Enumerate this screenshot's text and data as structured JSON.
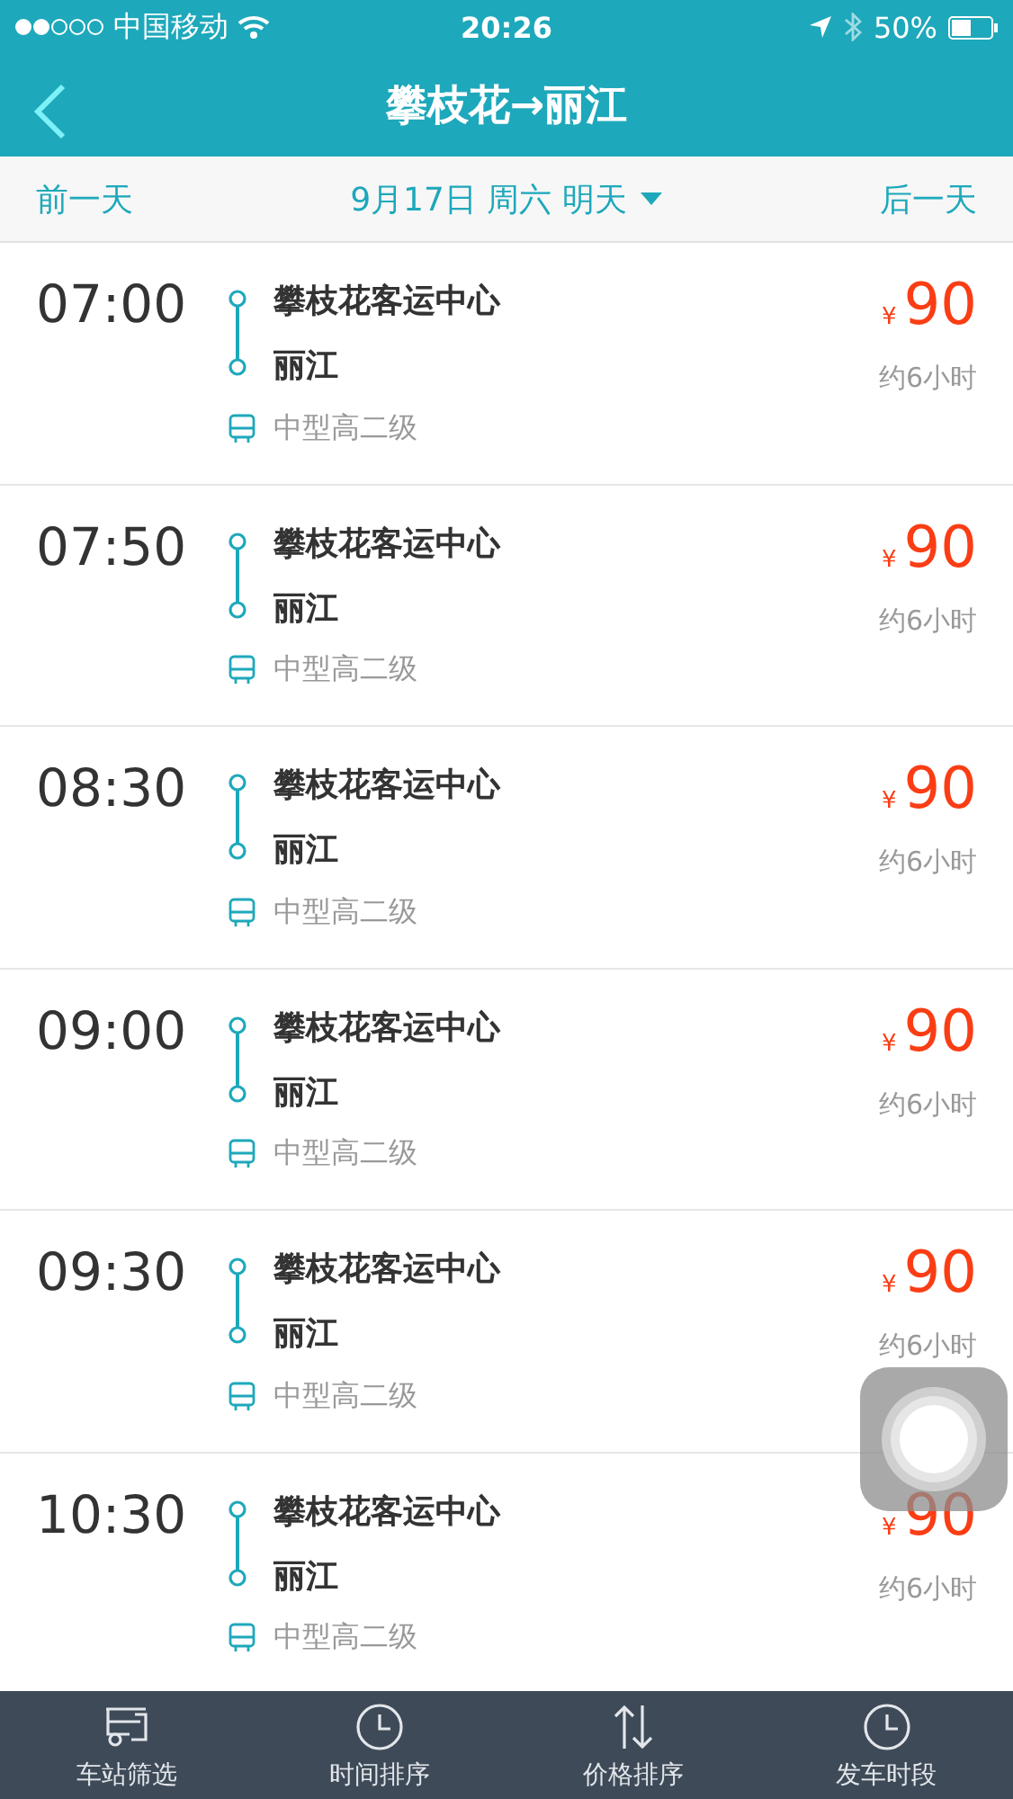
{
  "status_bar": {
    "carrier": "中国移动",
    "time": "20:26",
    "battery": "50%"
  },
  "nav": {
    "title": "攀枝花→丽江"
  },
  "date_bar": {
    "prev": "前一天",
    "date": "9月17日 周六 明天",
    "next": "后一天"
  },
  "trips": [
    {
      "time": "07:00",
      "from": "攀枝花客运中心",
      "to": "丽江",
      "bus_type": "中型高二级",
      "currency": "¥",
      "price": "90",
      "duration": "约6小时"
    },
    {
      "time": "07:50",
      "from": "攀枝花客运中心",
      "to": "丽江",
      "bus_type": "中型高二级",
      "currency": "¥",
      "price": "90",
      "duration": "约6小时"
    },
    {
      "time": "08:30",
      "from": "攀枝花客运中心",
      "to": "丽江",
      "bus_type": "中型高二级",
      "currency": "¥",
      "price": "90",
      "duration": "约6小时"
    },
    {
      "time": "09:00",
      "from": "攀枝花客运中心",
      "to": "丽江",
      "bus_type": "中型高二级",
      "currency": "¥",
      "price": "90",
      "duration": "约6小时"
    },
    {
      "time": "09:30",
      "from": "攀枝花客运中心",
      "to": "丽江",
      "bus_type": "中型高二级",
      "currency": "¥",
      "price": "90",
      "duration": "约6小时"
    },
    {
      "time": "10:30",
      "from": "攀枝花客运中心",
      "to": "丽江",
      "bus_type": "中型高二级",
      "currency": "¥",
      "price": "90",
      "duration": "约6小时"
    }
  ],
  "toolbar": [
    {
      "kind": "station",
      "label": "车站筛选"
    },
    {
      "kind": "time",
      "label": "时间排序"
    },
    {
      "kind": "price",
      "label": "价格排序"
    },
    {
      "kind": "period",
      "label": "发车时段"
    }
  ]
}
